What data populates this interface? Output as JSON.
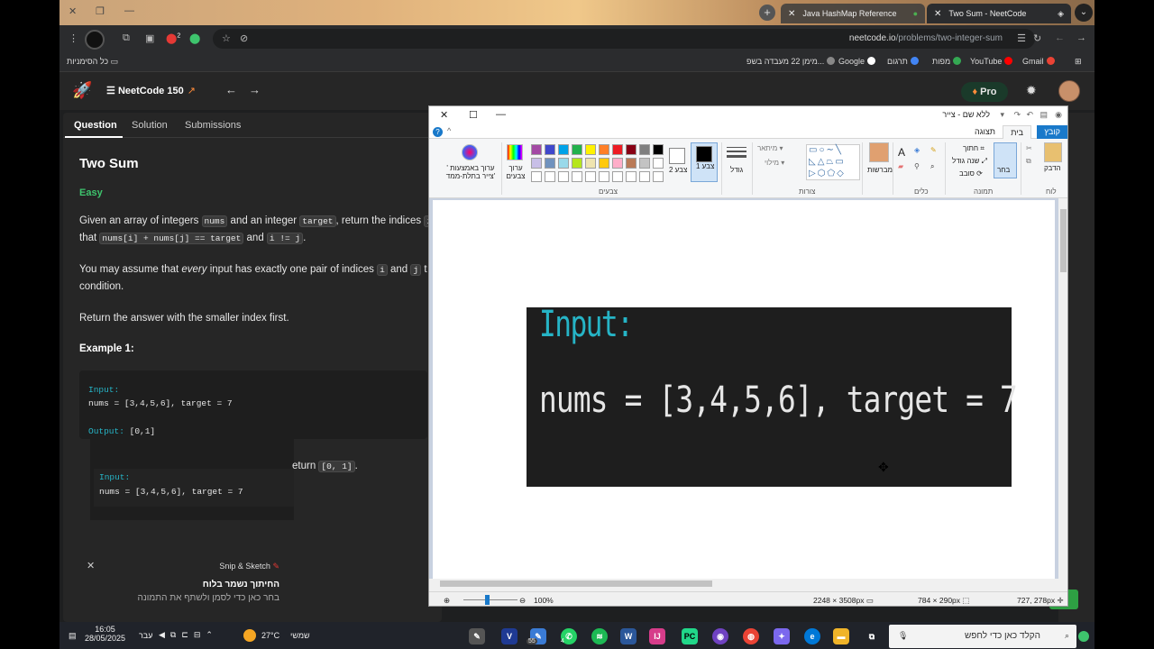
{
  "chrome": {
    "tabs": [
      {
        "label": "Java HashMap Reference",
        "active": false
      },
      {
        "label": "Two Sum - NeetCode",
        "active": true
      }
    ],
    "url_host": "neetcode.io",
    "url_path": "/problems/two-integer-sum",
    "profile_badge": "2",
    "bookmarks": [
      {
        "label": "Gmail",
        "icon": "gmail-icon"
      },
      {
        "label": "YouTube",
        "icon": "youtube-icon"
      },
      {
        "label": "מפות",
        "icon": "maps-icon"
      },
      {
        "label": "תרגום",
        "icon": "translate-icon"
      },
      {
        "label": "Google",
        "icon": "google-icon"
      },
      {
        "label": "מימן 22 מעבדה בשפ...",
        "icon": "page-icon"
      }
    ],
    "all_bookmarks": "כל הסימניות"
  },
  "app": {
    "nav_title": "NeetCode 150",
    "pro_label": "Pro",
    "accent": "#3ec46d"
  },
  "question": {
    "tabs": [
      "Question",
      "Solution",
      "Submissions"
    ],
    "title": "Two Sum",
    "difficulty": "Easy",
    "p1_a": "Given an array of integers",
    "p1_code1": "nums",
    "p1_b": "and an integer",
    "p1_code2": "target",
    "p1_c": ", return the indices",
    "p1_code3": "i",
    "p2_a": "that",
    "p2_code1": "nums[i] + nums[j] == target",
    "p2_b": "and",
    "p2_code2": "i != j",
    "p2_c": ".",
    "p3_a": "You may assume that",
    "p3_em": "every",
    "p3_b": "input has exactly one pair of indices",
    "p3_code1": "i",
    "p3_c": "and",
    "p3_code2": "j",
    "p3_d": "t",
    "p4": "condition.",
    "p5": "Return the answer with the smaller index first.",
    "example_title": "Example 1:",
    "ex_input_label": "Input:",
    "ex_input": "nums = [3,4,5,6], target = 7",
    "ex_output_label": "Output:",
    "ex_output": "[0,1]",
    "return_a": "eturn",
    "return_code": "[0, 1]",
    "return_b": "."
  },
  "snip_toast": {
    "app": "Snip & Sketch",
    "line1": "החיתוך נשמר בלוח",
    "line2": "בחר כאן כדי לסמן ולשתף את התמונה"
  },
  "paint": {
    "title": "ללא שם - צייר",
    "tabs": [
      "קובץ",
      "בית",
      "תצוגה"
    ],
    "groups": {
      "clipboard": "לוח",
      "image": "תמונה",
      "tools": "כלים",
      "shapes": "צורות",
      "colors": "צבעים"
    },
    "labels": {
      "paste": "הדבק",
      "select": "בחר",
      "crop": "חתוך",
      "resize": "שנה גודל",
      "rotate": "סובב",
      "brushes": "מברשות",
      "outline": "מיתאר",
      "fill": "מילוי",
      "size": "גודל",
      "color1": "צבע 1",
      "color2": "צבע 2",
      "edit_colors": "ערוך צבעים",
      "edit_3d": "ערוך באמצעות ' צייר בתלת-ממד'"
    },
    "palette": [
      "#000000",
      "#7f7f7f",
      "#880015",
      "#ed1c24",
      "#ff7f27",
      "#fff200",
      "#22b14c",
      "#00a2e8",
      "#3f48cc",
      "#a349a4",
      "#ffffff",
      "#c3c3c3",
      "#b97a57",
      "#ffaec9",
      "#ffc90e",
      "#efe4b0",
      "#b5e61d",
      "#99d9ea",
      "#7092be",
      "#c8bfe7"
    ],
    "pasted_input": "Input:",
    "pasted_nums": "nums = [3,4,5,6], target = 7",
    "status": {
      "cursor_pos": "727, 278px",
      "selection": "784 × 290px",
      "canvas_size": "2248 × 3508px",
      "zoom": "100%"
    }
  },
  "taskbar": {
    "search_placeholder": "הקלד כאן כדי לחפש",
    "weather_temp": "27°C",
    "weather_desc": "שמשי",
    "lang": "עבר",
    "time": "16:05",
    "date": "28/05/2025",
    "badge1": "55",
    "badge2": "4"
  }
}
